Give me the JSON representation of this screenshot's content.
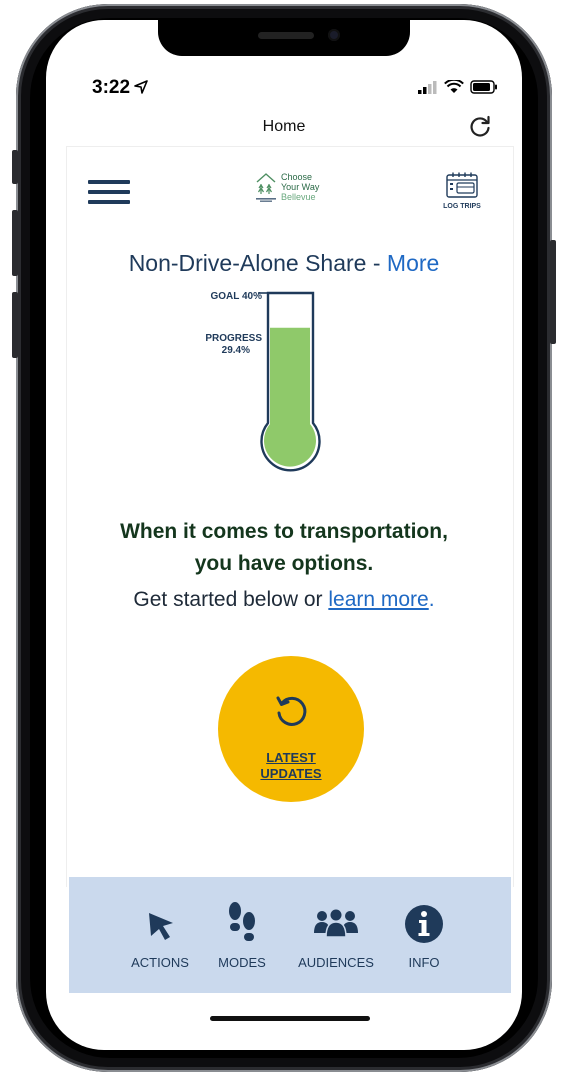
{
  "status_bar": {
    "time": "3:22"
  },
  "nav": {
    "title": "Home"
  },
  "header": {
    "logo_lines": [
      "Choose",
      "Your Way",
      "Bellevue"
    ],
    "log_trips_label": "LOG TRIPS"
  },
  "share": {
    "title": "Non-Drive-Alone Share - ",
    "more_link": "More",
    "goal_label": "GOAL 40%",
    "progress_label_1": "PROGRESS",
    "progress_label_2": "29.4%",
    "goal_percent": 40,
    "progress_percent": 29.4
  },
  "message": {
    "line1": "When it comes to transportation,",
    "line2": "you have options.",
    "sub_prefix": "Get started below or ",
    "sub_link": "learn more",
    "sub_suffix": "."
  },
  "updates_button": {
    "line1": "LATEST",
    "line2": "UPDATES"
  },
  "tabs": [
    {
      "label": "ACTIONS",
      "icon": "cursor-arrow-icon"
    },
    {
      "label": "MODES",
      "icon": "footprints-icon"
    },
    {
      "label": "AUDIENCES",
      "icon": "people-group-icon"
    },
    {
      "label": "INFO",
      "icon": "info-circle-icon"
    }
  ],
  "colors": {
    "navy": "#1f3a5a",
    "link_blue": "#1f69c4",
    "thermo_green": "#8fc96a",
    "updates_yellow": "#f5b900",
    "tabbar_bg": "#cad9ed"
  }
}
